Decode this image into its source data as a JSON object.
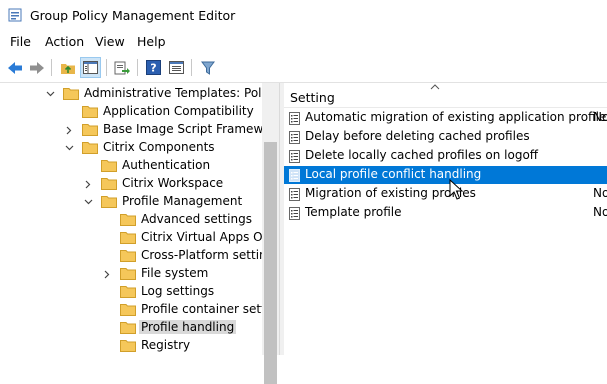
{
  "window": {
    "title": "Group Policy Management Editor"
  },
  "menu": [
    {
      "label": "File"
    },
    {
      "label": "Action"
    },
    {
      "label": "View"
    },
    {
      "label": "Help"
    }
  ],
  "toolbar": {
    "buttons": [
      "back-icon",
      "forward-icon",
      "up-folder-icon",
      "show-hide-tree-icon",
      "export-list-icon",
      "help-icon",
      "properties-icon",
      "filter-icon"
    ]
  },
  "tree": {
    "items": [
      {
        "label": "Administrative Templates: Policy",
        "expander": "expanded"
      },
      {
        "label": "Application Compatibility",
        "expander": "none"
      },
      {
        "label": "Base Image Script Framework",
        "expander": "collapsed"
      },
      {
        "label": "Citrix Components",
        "expander": "expanded"
      },
      {
        "label": "Authentication",
        "expander": "none"
      },
      {
        "label": "Citrix Workspace",
        "expander": "collapsed"
      },
      {
        "label": "Profile Management",
        "expander": "expanded"
      },
      {
        "label": "Advanced settings",
        "expander": "none"
      },
      {
        "label": "Citrix Virtual Apps Opti",
        "expander": "none"
      },
      {
        "label": "Cross-Platform setting",
        "expander": "none"
      },
      {
        "label": "File system",
        "expander": "collapsed"
      },
      {
        "label": "Log settings",
        "expander": "none"
      },
      {
        "label": "Profile container settin",
        "expander": "none"
      },
      {
        "label": "Profile handling",
        "expander": "none",
        "selected": true
      },
      {
        "label": "Registry",
        "expander": "none"
      }
    ]
  },
  "details": {
    "column_header": "Setting",
    "rows": [
      {
        "name": "Automatic migration of existing application profiles",
        "state": "No"
      },
      {
        "name": "Delay before deleting cached profiles",
        "state": ""
      },
      {
        "name": "Delete locally cached profiles on logoff",
        "state": ""
      },
      {
        "name": "Local profile conflict handling",
        "state": "",
        "selected": true
      },
      {
        "name": "Migration of existing profiles",
        "state": "No"
      },
      {
        "name": "Template profile",
        "state": "No"
      }
    ]
  },
  "colors": {
    "selection": "#0078d7",
    "folder": "#f5c75a",
    "tree_selected": "#d9d9d9"
  }
}
